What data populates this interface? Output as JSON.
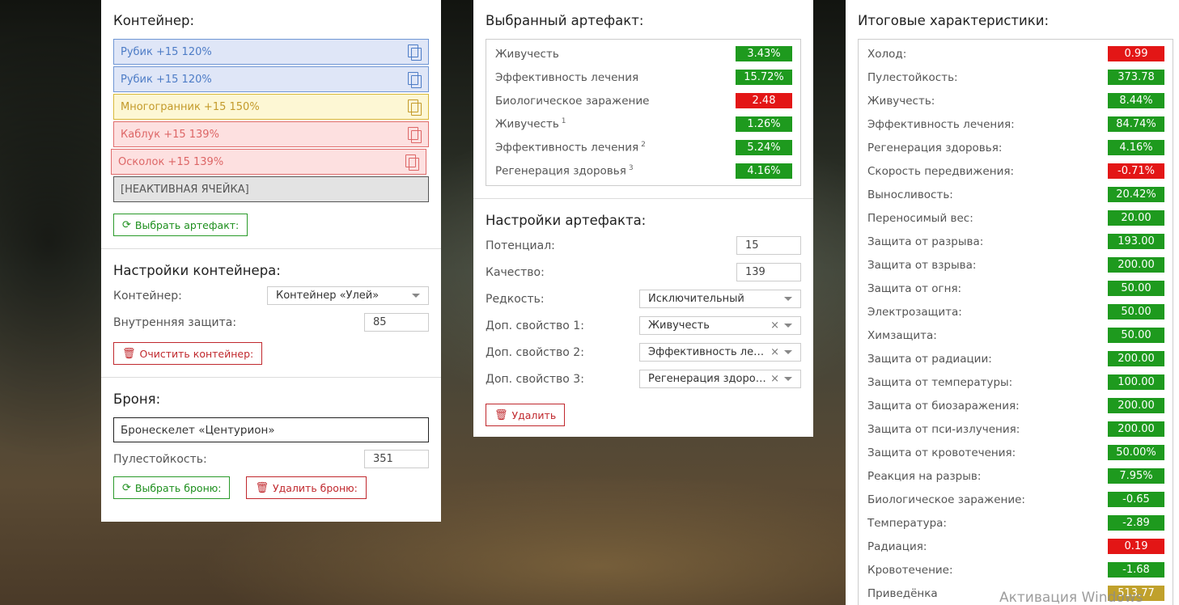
{
  "container_panel": {
    "title": "Контейнер:",
    "slots": [
      {
        "label": "Рубик +15 120%",
        "color": "blue"
      },
      {
        "label": "Рубик +15 120%",
        "color": "blue"
      },
      {
        "label": "Многогранник +15 150%",
        "color": "yellow"
      },
      {
        "label": "Каблук +15 139%",
        "color": "red"
      },
      {
        "label": "Осколок +15 139%",
        "color": "red"
      },
      {
        "label": "[НЕАКТИВНАЯ ЯЧЕЙКА]",
        "color": "gray"
      }
    ],
    "choose_artifact_label": "Выбрать артефакт:"
  },
  "container_settings": {
    "title": "Настройки контейнера:",
    "container_label": "Контейнер:",
    "container_value": "Контейнер «Улей»",
    "inner_protection_label": "Внутренняя защита:",
    "inner_protection_value": "85",
    "clear_label": "Очистить контейнер:"
  },
  "armor": {
    "title": "Броня:",
    "name": "Бронескелет «Центурион»",
    "bullet_label": "Пулестойкость:",
    "bullet_value": "351",
    "choose_label": "Выбрать броню:",
    "delete_label": "Удалить броню:"
  },
  "selected_artifact": {
    "title": "Выбранный артефакт:",
    "stats": [
      {
        "label": "Живучесть",
        "sup": "",
        "value": "3.43%",
        "color": "g"
      },
      {
        "label": "Эффективность лечения",
        "sup": "",
        "value": "15.72%",
        "color": "g"
      },
      {
        "label": "Биологическое заражение",
        "sup": "",
        "value": "2.48",
        "color": "r"
      },
      {
        "label": "Живучесть",
        "sup": "1",
        "value": "1.26%",
        "color": "g"
      },
      {
        "label": "Эффективность лечения",
        "sup": "2",
        "value": "5.24%",
        "color": "g"
      },
      {
        "label": "Регенерация здоровья",
        "sup": "3",
        "value": "4.16%",
        "color": "g"
      }
    ]
  },
  "artifact_settings": {
    "title": "Настройки артефакта:",
    "potential_label": "Потенциал:",
    "potential_value": "15",
    "quality_label": "Качество:",
    "quality_value": "139",
    "rarity_label": "Редкость:",
    "rarity_value": "Исключительный",
    "extra1_label": "Доп. свойство 1:",
    "extra1_value": "Живучесть",
    "extra2_label": "Доп. свойство 2:",
    "extra2_value": "Эффективность лечения",
    "extra3_label": "Доп. свойство 3:",
    "extra3_value": "Регенерация здоровья",
    "delete_label": "Удалить"
  },
  "totals": {
    "title": "Итоговые характеристики:",
    "stats": [
      {
        "label": "Холод:",
        "value": "0.99",
        "color": "r"
      },
      {
        "label": "Пулестойкость:",
        "value": "373.78",
        "color": "g"
      },
      {
        "label": "Живучесть:",
        "value": "8.44%",
        "color": "g"
      },
      {
        "label": "Эффективность лечения:",
        "value": "84.74%",
        "color": "g"
      },
      {
        "label": "Регенерация здоровья:",
        "value": "4.16%",
        "color": "g"
      },
      {
        "label": "Скорость передвижения:",
        "value": "-0.71%",
        "color": "r"
      },
      {
        "label": "Выносливость:",
        "value": "20.42%",
        "color": "g"
      },
      {
        "label": "Переносимый вес:",
        "value": "20.00",
        "color": "g"
      },
      {
        "label": "Защита от разрыва:",
        "value": "193.00",
        "color": "g"
      },
      {
        "label": "Защита от взрыва:",
        "value": "200.00",
        "color": "g"
      },
      {
        "label": "Защита от огня:",
        "value": "50.00",
        "color": "g"
      },
      {
        "label": "Электрозащита:",
        "value": "50.00",
        "color": "g"
      },
      {
        "label": "Химзащита:",
        "value": "50.00",
        "color": "g"
      },
      {
        "label": "Защита от радиации:",
        "value": "200.00",
        "color": "g"
      },
      {
        "label": "Защита от температуры:",
        "value": "100.00",
        "color": "g"
      },
      {
        "label": "Защита от биозаражения:",
        "value": "200.00",
        "color": "g"
      },
      {
        "label": "Защита от пси-излучения:",
        "value": "200.00",
        "color": "g"
      },
      {
        "label": "Защита от кровотечения:",
        "value": "50.00%",
        "color": "g"
      },
      {
        "label": "Реакция на разрыв:",
        "value": "7.95%",
        "color": "g"
      },
      {
        "label": "Биологическое заражение:",
        "value": "-0.65",
        "color": "g"
      },
      {
        "label": "Температура:",
        "value": "-2.89",
        "color": "g"
      },
      {
        "label": "Радиация:",
        "value": "0.19",
        "color": "r"
      },
      {
        "label": "Кровотечение:",
        "value": "-1.68",
        "color": "g"
      },
      {
        "label": "Приведёнка",
        "value": "513.77",
        "color": "y"
      }
    ]
  },
  "watermark": "Активация Windows",
  "colors": {
    "green": "#1e9a1e",
    "red": "#e31616",
    "gold": "#c0a12c"
  }
}
